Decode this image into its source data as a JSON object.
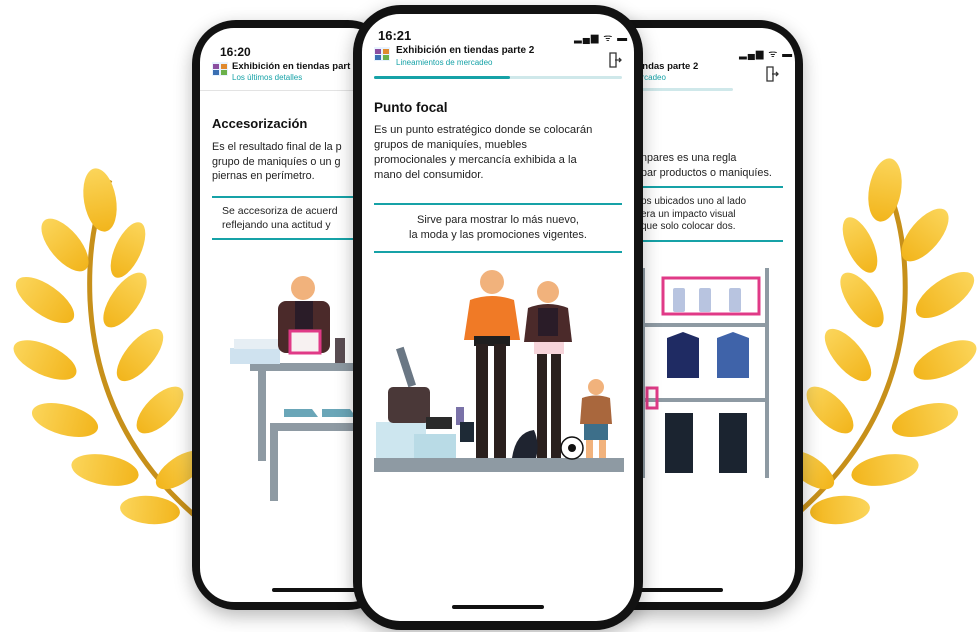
{
  "colors": {
    "accent": "#16a2a7",
    "laurel_gold": "#f7c52e",
    "phone_frame": "#121212"
  },
  "phones": {
    "left": {
      "time": "16:20",
      "app_title": "Exhibición en tiendas part",
      "app_subtitle": "Los últimos detalles",
      "section_title": "Accesorización",
      "body_lines": [
        "Es el resultado final de la p",
        "grupo de maniquíes o un g",
        "piernas en perímetro."
      ],
      "highlight_lines": [
        "Se accesoriza de acuerd",
        "reflejando una actitud y"
      ]
    },
    "center": {
      "time": "16:21",
      "signal_icons": "▂▄▆ ᯤ ▬",
      "app_title": "Exhibición en tiendas parte 2",
      "app_subtitle": "Lineamientos de mercadeo",
      "progress_fraction": 0.55,
      "section_title": "Punto focal",
      "body_lines": [
        "Es un punto estratégico donde se colocarán",
        "grupos de maniquíes, muebles",
        "promocionales y mercancía exhibida a la",
        "mano del consumidor."
      ],
      "highlight_lines": [
        "Sirve para mostrar lo más nuevo,",
        "la moda y las promociones vigentes."
      ]
    },
    "right": {
      "signal_icons": "▂▄▆ ᯤ ▬",
      "app_title": "endas parte 2",
      "app_subtitle": "ercadeo",
      "body_lines": [
        "npares es una regla",
        "par productos o maniquíes."
      ],
      "highlight_lines": [
        "ps ubicados uno al lado",
        "era un impacto visual",
        "que solo colocar dos."
      ]
    }
  },
  "icons": {
    "app_icon": "store-shelf-icon",
    "exit_icon": "exit-door-icon",
    "decoration": "laurel-wreath"
  }
}
